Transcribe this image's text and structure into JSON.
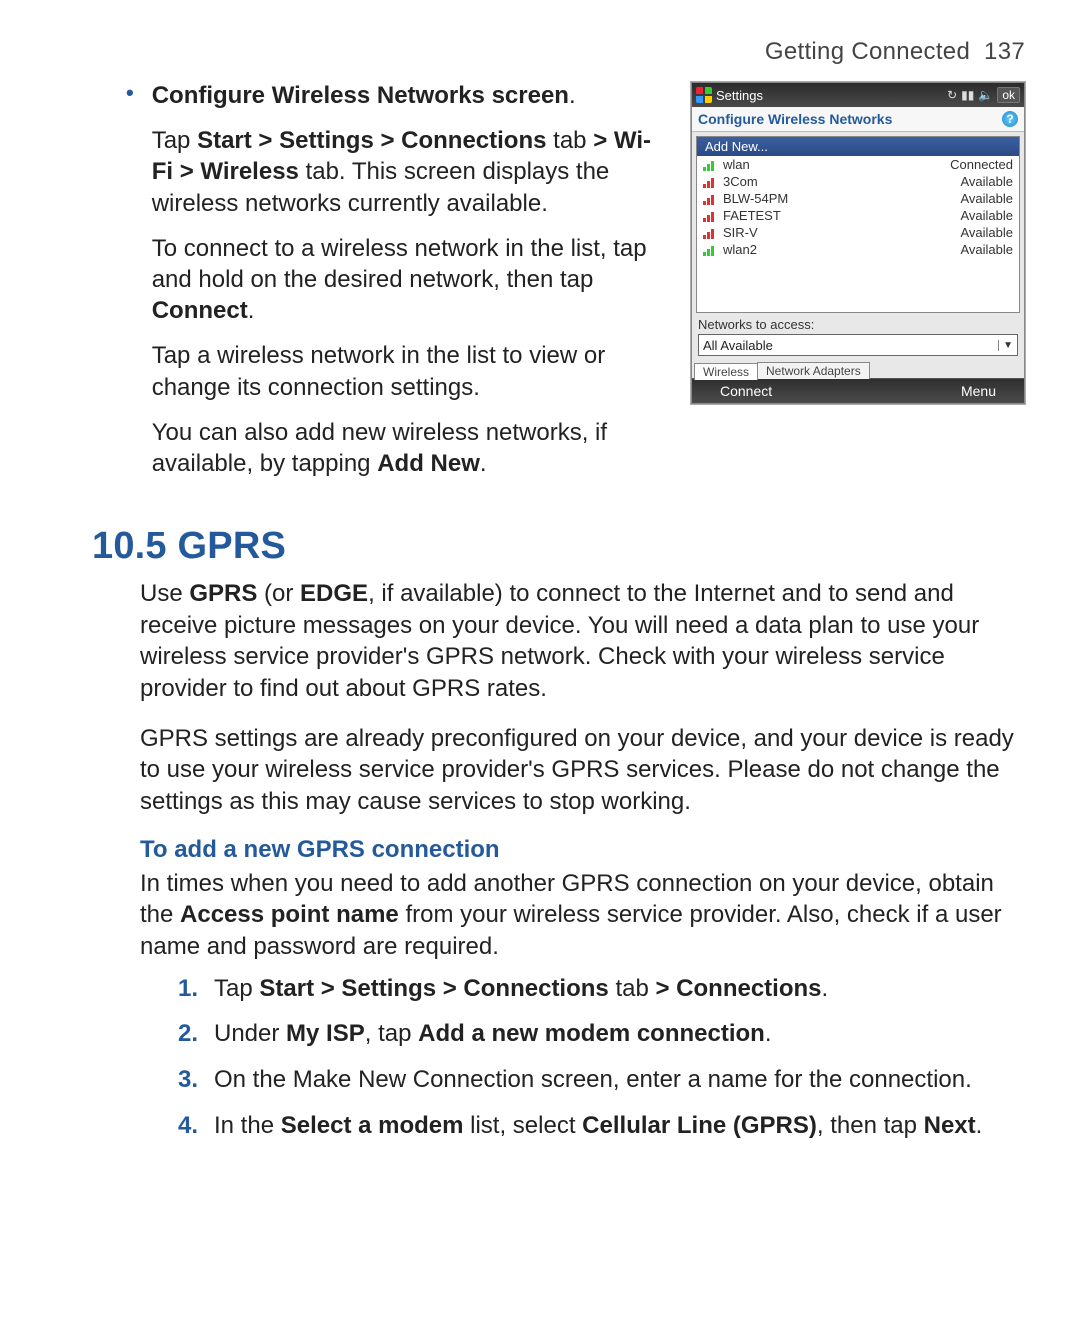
{
  "header": {
    "chapter": "Getting Connected",
    "page_no": "137"
  },
  "bullet": {
    "title_bold": "Configure Wireless Networks screen",
    "title_suffix": ".",
    "p1_pre": "Tap ",
    "p1_b1": "Start > Settings > Connections",
    "p1_mid1": " tab ",
    "p1_b2": "> Wi-Fi > Wireless",
    "p1_post": " tab. This screen displays the wireless networks currently available.",
    "p2_pre": "To connect to a wireless network in the list, tap and hold on the desired network, then tap ",
    "p2_b": "Connect",
    "p2_post": ".",
    "p3": "Tap a wireless network in the list to view or change its connection settings.",
    "p4_pre": "You can also add new wireless networks, if available, by tapping ",
    "p4_b": "Add New",
    "p4_post": "."
  },
  "device": {
    "topbar_title": "Settings",
    "ok": "ok",
    "screen_title": "Configure Wireless Networks",
    "add_new": "Add New...",
    "nets": [
      {
        "name": "wlan",
        "status": "Connected",
        "red": false
      },
      {
        "name": "3Com",
        "status": "Available",
        "red": true
      },
      {
        "name": "BLW-54PM",
        "status": "Available",
        "red": true
      },
      {
        "name": "FAETEST",
        "status": "Available",
        "red": true
      },
      {
        "name": "SIR-V",
        "status": "Available",
        "red": true
      },
      {
        "name": "wlan2",
        "status": "Available",
        "red": false
      }
    ],
    "access_label": "Networks to access:",
    "dropdown_value": "All Available",
    "tabs": [
      "Wireless",
      "Network Adapters"
    ],
    "soft_left": "Connect",
    "soft_right": "Menu"
  },
  "section": {
    "heading": "10.5  GPRS",
    "para1_pre": "Use ",
    "para1_b1": "GPRS",
    "para1_mid1": " (or ",
    "para1_b2": "EDGE",
    "para1_post": ", if available) to connect to the Internet and to send and receive picture messages on your device. You will need a data plan to use your wireless service provider's GPRS network. Check with your wireless service provider to find out about GPRS rates.",
    "para2": "GPRS settings are already preconfigured on your device, and your device is ready to use your wireless service provider's GPRS services. Please do not change the settings as this may cause services to stop working.",
    "sub_heading": "To add a new GPRS connection",
    "para3_pre": "In times when you need to add another GPRS connection on your device, obtain the ",
    "para3_b": "Access point name",
    "para3_post": " from your wireless service provider. Also, check if a user name and password are required.",
    "steps": {
      "s1_pre": "Tap ",
      "s1_b1": "Start > Settings > Connections",
      "s1_mid": " tab ",
      "s1_b2": "> Connections",
      "s1_post": ".",
      "s2_pre": "Under ",
      "s2_b1": "My ISP",
      "s2_mid": ", tap ",
      "s2_b2": "Add a new modem connection",
      "s2_post": ".",
      "s3": "On the Make New Connection screen, enter a name for the connection.",
      "s4_pre": "In the ",
      "s4_b1": "Select a modem",
      "s4_mid": " list, select ",
      "s4_b2": "Cellular Line (GPRS)",
      "s4_mid2": ", then tap ",
      "s4_b3": "Next",
      "s4_post": "."
    },
    "nums": {
      "n1": "1.",
      "n2": "2.",
      "n3": "3.",
      "n4": "4."
    }
  }
}
